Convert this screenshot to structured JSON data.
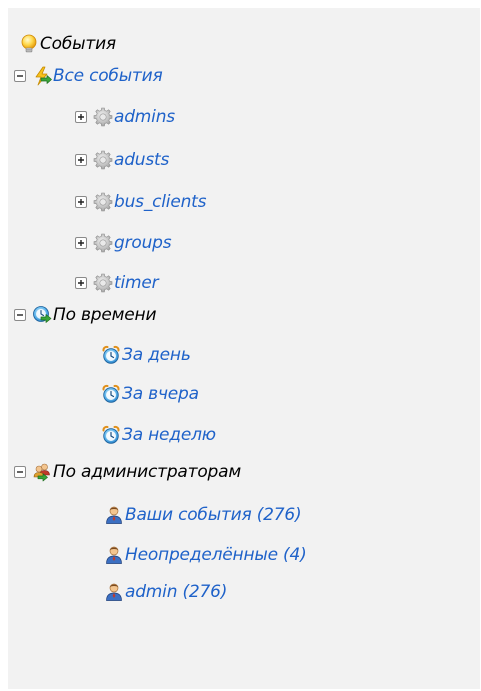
{
  "tree": {
    "root": {
      "label": "События",
      "icon": "lightbulb-icon"
    },
    "all_events": {
      "label": "Все события",
      "icon": "lightning-arrow-icon",
      "expanded": true,
      "children": [
        {
          "label": "admins",
          "icon": "gear-icon",
          "expanded": false
        },
        {
          "label": "adusts",
          "icon": "gear-icon",
          "expanded": false
        },
        {
          "label": "bus_clients",
          "icon": "gear-icon",
          "expanded": false
        },
        {
          "label": "groups",
          "icon": "gear-icon",
          "expanded": false
        },
        {
          "label": "timer",
          "icon": "gear-icon",
          "expanded": false
        }
      ]
    },
    "by_time": {
      "label": "По времени",
      "icon": "clock-arrow-icon",
      "expanded": true,
      "children": [
        {
          "label": "За день",
          "icon": "alarm-clock-icon"
        },
        {
          "label": "За вчера",
          "icon": "alarm-clock-icon"
        },
        {
          "label": "За неделю",
          "icon": "alarm-clock-icon"
        }
      ]
    },
    "by_admin": {
      "label": "По администраторам",
      "icon": "users-arrow-icon",
      "expanded": true,
      "children": [
        {
          "label": "Ваши события (276)",
          "icon": "user-icon"
        },
        {
          "label": "Неопределённые (4)",
          "icon": "user-icon"
        },
        {
          "label": "admin (276)",
          "icon": "user-icon"
        }
      ]
    }
  },
  "colors": {
    "link": "#1f62c9",
    "text": "#000000",
    "panel_background": "#f2f2f2"
  }
}
